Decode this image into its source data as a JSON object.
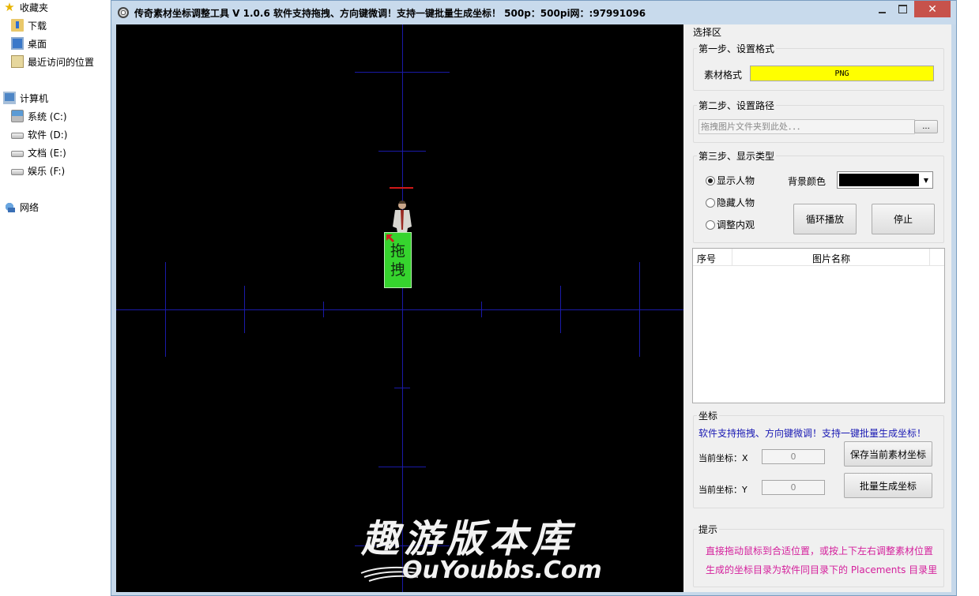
{
  "explorer": {
    "favorites": "收藏夹",
    "downloads": "下载",
    "desktop": "桌面",
    "recent": "最近访问的位置",
    "computer": "计算机",
    "drives": [
      "系统 (C:)",
      "软件 (D:)",
      "文档 (E:)",
      "娱乐 (F:)"
    ],
    "network": "网络"
  },
  "window": {
    "title": "传奇素材坐标调整工具 V 1.0.6  软件支持拖拽、方向键微调！支持一键批量生成坐标！ 500p：500pi网：:97991096",
    "close": "✕"
  },
  "canvas": {
    "drag_tile": [
      "拖",
      "拽"
    ],
    "watermark_cn": "趣游版本库",
    "watermark_en": "OuYoubbs.Com"
  },
  "panel": {
    "select_area": "选择区",
    "step1": {
      "title": "第一步、设置格式",
      "format_label": "素材格式",
      "format_value": "PNG"
    },
    "step2": {
      "title": "第二步、设置路径",
      "path_placeholder": "拖拽图片文件夹到此处．．．",
      "browse": "..."
    },
    "step3": {
      "title": "第三步、显示类型",
      "radios": [
        "显示人物",
        "隐藏人物",
        "调整内观"
      ],
      "bg_label": "背景颜色",
      "loop_button": "循环播放",
      "stop_button": "停止"
    },
    "list": {
      "col_index": "序号",
      "col_name": "图片名称"
    },
    "coords": {
      "title": "坐标",
      "tip": "软件支持拖拽、方向键微调！支持一键批量生成坐标！",
      "x_label": "当前坐标：X",
      "x_value": "0",
      "y_label": "当前坐标：Y",
      "y_value": "0",
      "save_button": "保存当前素材坐标",
      "batch_button": "批量生成坐标"
    },
    "hint": {
      "title": "提示",
      "line1": "直接拖动鼠标到合适位置，或按上下左右调整素材位置",
      "line2": "生成的坐标目录为软件同目录下的 Placements 目录里"
    }
  },
  "colors": {
    "format_bg": "#ffff00",
    "canvas_bg": "#000000",
    "guide_line": "#1a1aa8",
    "tip_text": "#1a1ab4",
    "hint_text": "#d4209c",
    "close_button": "#c7524b"
  }
}
